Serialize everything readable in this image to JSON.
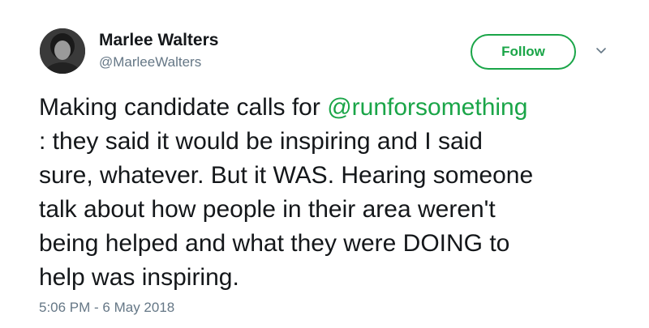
{
  "author": {
    "display_name": "Marlee Walters",
    "handle": "@MarleeWalters"
  },
  "follow_button": {
    "label": "Follow"
  },
  "colors": {
    "accent": "#1aa548",
    "text": "#14171a",
    "muted": "#657786"
  },
  "icons": {
    "menu": "chevron-down-icon"
  },
  "tweet": {
    "line1_prefix": "Making candidate calls for ",
    "mention": "@runforsomething",
    "line2": ": they said it would be inspiring and I said",
    "line3": "sure, whatever. But it WAS. Hearing someone",
    "line4": "talk about how people in their area weren't",
    "line5": "being helped and what they were DOING to",
    "line6": "help was inspiring."
  },
  "timestamp": "5:06 PM - 6 May 2018"
}
